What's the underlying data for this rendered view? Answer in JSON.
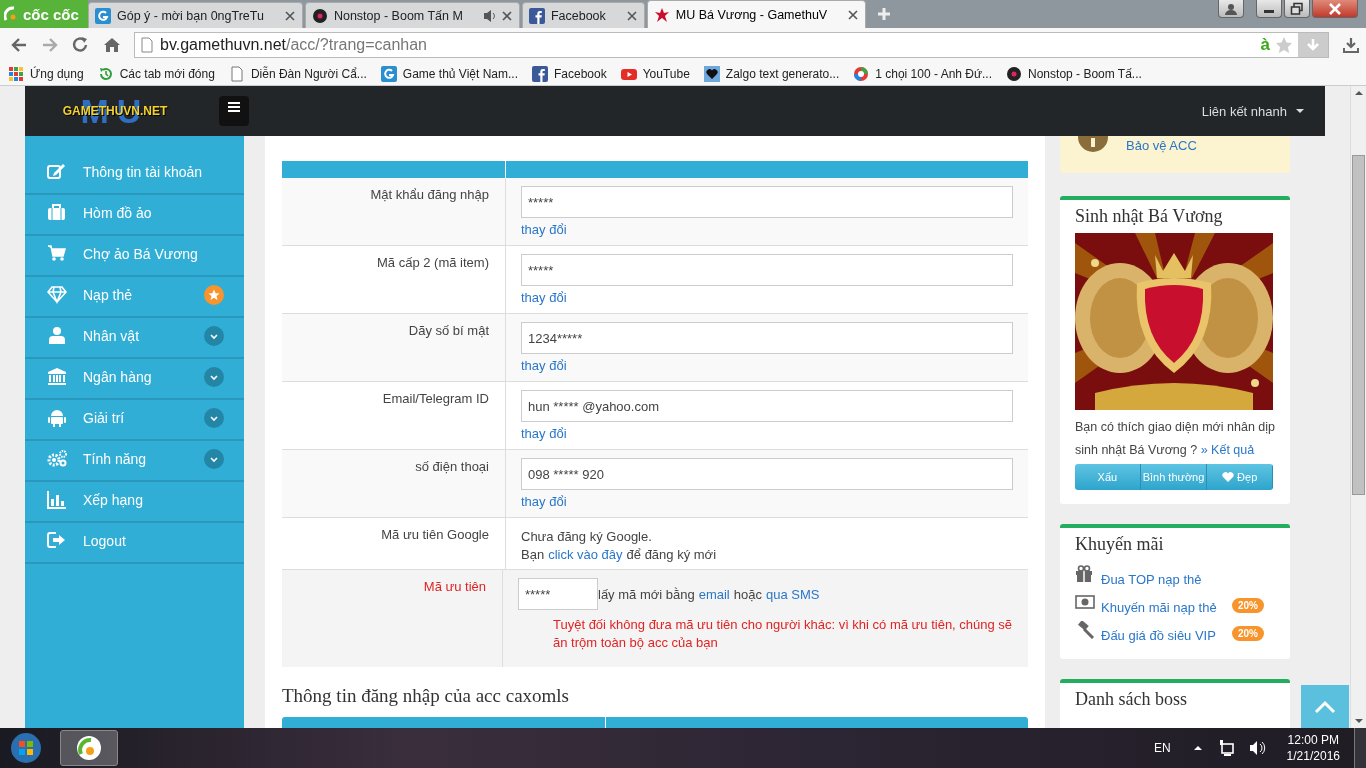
{
  "browser": {
    "brand": "cốc cốc",
    "tabs": [
      {
        "title": "Góp ý - mời bạn 0ngTreTu",
        "audio": false,
        "selected": false
      },
      {
        "title": "Nonstop - Boom Tấn M",
        "audio": true,
        "selected": false
      },
      {
        "title": "Facebook",
        "audio": false,
        "selected": false
      },
      {
        "title": "MU Bá Vương - GamethuV",
        "audio": false,
        "selected": true
      }
    ],
    "url_host": "bv.gamethuvn.net",
    "url_path": "/acc/?trang=canhan",
    "addon": "à",
    "bookmarks": [
      {
        "title": "Ứng dụng"
      },
      {
        "title": "Các tab mới đóng"
      },
      {
        "title": "Diễn Đàn Người Cẩ..."
      },
      {
        "title": "Game thủ Việt Nam..."
      },
      {
        "title": "Facebook"
      },
      {
        "title": "YouTube"
      },
      {
        "title": "Zalgo text generato..."
      },
      {
        "title": "1 chọi 100 - Anh Đứ..."
      },
      {
        "title": "Nonstop - Boom Tấ..."
      }
    ]
  },
  "site": {
    "logo": {
      "backdrop": "MU",
      "text": "GAMETHUVN.NET"
    },
    "quick_links": "Liên kết nhanh",
    "sidebar": [
      {
        "label": "Thông tin tài khoản"
      },
      {
        "label": "Hòm đồ ảo"
      },
      {
        "label": "Chợ ảo Bá Vương"
      },
      {
        "label": "Nạp thẻ",
        "starred": true
      },
      {
        "label": "Nhân vật",
        "expanded": false
      },
      {
        "label": "Ngân hàng",
        "expanded": false
      },
      {
        "label": "Giải trí",
        "expanded": false
      },
      {
        "label": "Tính năng",
        "expanded": false
      },
      {
        "label": "Xếp hạng"
      },
      {
        "label": "Logout"
      }
    ],
    "account_rows": [
      {
        "label": "Mật khẩu đăng nhập",
        "kind": "input",
        "value": "*****",
        "link": "thay đổi"
      },
      {
        "label": "Mã cấp 2 (mã item)",
        "kind": "input",
        "value": "*****",
        "link": "thay đổi"
      },
      {
        "label": "Dãy số bí mật",
        "kind": "input",
        "value": "1234*****",
        "link": "thay đổi"
      },
      {
        "label": "Email/Telegram ID",
        "kind": "input",
        "value": "hun ***** @yahoo.com",
        "link": "thay đổi"
      },
      {
        "label": "số điện thoại",
        "kind": "input",
        "value": "098 ***** 920",
        "link": "thay đổi"
      },
      {
        "label": "Mã ưu tiên Google",
        "kind": "text",
        "line": "Chưa đăng ký Google.",
        "before": "Bạn",
        "link": "click vào đây",
        "after": "để đăng ký mới"
      },
      {
        "label": "Mã ưu tiên",
        "kind": "code",
        "value": "*****",
        "before": "lấy mã mới bằng",
        "link": "email",
        "middle": "hoặc",
        "link2": "qua SMS",
        "warning": "Tuyệt đối không đưa mã ưu tiên cho người khác: vì khi có mã ưu tiên, chúng sẽ ăn trộm toàn bộ acc của bạn"
      }
    ],
    "login_heading": "Thông tin đăng nhập của acc caxomls",
    "protect_link": "Bảo vệ ACC",
    "birthday": {
      "title": "Sinh nhật Bá Vương",
      "question": "Bạn có thích giao diện mới nhân dịp sinh nhật Bá Vương ?",
      "result_link": "» Kết quả",
      "votes": [
        {
          "label": "Xấu"
        },
        {
          "label": "Bình thường"
        },
        {
          "label": "Đẹp"
        }
      ]
    },
    "promo": {
      "title": "Khuyến mãi",
      "items": [
        {
          "label": "Đua TOP nạp thẻ"
        },
        {
          "label": "Khuyến mãi nạp thẻ",
          "badge": "20%"
        },
        {
          "label": "Đấu giá đồ siêu VIP",
          "badge": "20%"
        }
      ]
    },
    "boss_title": "Danh sách boss"
  },
  "taskbar": {
    "language": "EN",
    "time": "12:00 PM",
    "date": "1/21/2016"
  }
}
